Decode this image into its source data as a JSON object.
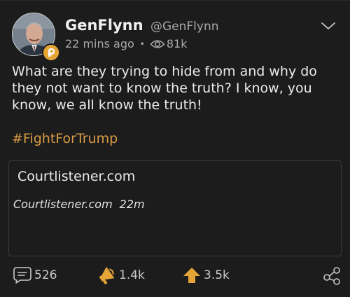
{
  "post": {
    "author_name": "GenFlynn",
    "handle": "@GenFlynn",
    "time_ago": "22 mins ago",
    "separator": "•",
    "views": "81k",
    "text": "What are they trying to hide from and why do they not want to know the truth? I know, you know, we all know the truth!",
    "hashtag": "#FightForTrump"
  },
  "link_card": {
    "title": "Courtlistener.com",
    "source": "Courtlistener.com",
    "age": "22m"
  },
  "actions": {
    "comments": "526",
    "echoes": "1.4k",
    "upvotes": "3.5k"
  },
  "icons": {
    "avatar": "profile-photo",
    "badge": "parler-badge-icon",
    "views": "eye-icon",
    "menu": "chevron-down-icon",
    "comment": "comment-icon",
    "echo": "echo-megaphone-icon",
    "upvote": "upvote-arrow-icon",
    "share": "share-icon"
  },
  "colors": {
    "background": "#1c1c1c",
    "accent": "#e4a436",
    "hashtag": "#d79a43"
  }
}
